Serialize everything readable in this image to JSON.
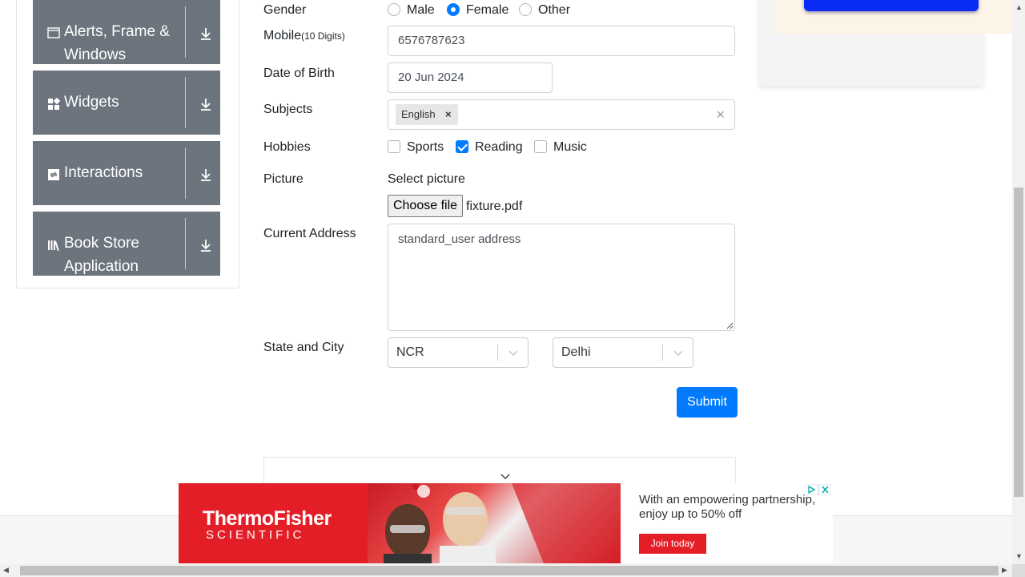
{
  "sidebar": {
    "groups": [
      {
        "title_line1": "Alerts, Frame &",
        "title_line2": "Windows",
        "icon": "window-icon"
      },
      {
        "title_line1": "Widgets",
        "icon": "widgets-icon"
      },
      {
        "title_line1": "Interactions",
        "icon": "interactions-icon"
      },
      {
        "title_line1": "Book Store",
        "title_line2": "Application",
        "icon": "books-icon"
      }
    ]
  },
  "form": {
    "gender": {
      "label": "Gender",
      "options": [
        "Male",
        "Female",
        "Other"
      ],
      "selected": "Female"
    },
    "mobile": {
      "label": "Mobile",
      "hint": "(10 Digits)",
      "value": "6576787623"
    },
    "dob": {
      "label": "Date of Birth",
      "value": "20 Jun 2024"
    },
    "subjects": {
      "label": "Subjects",
      "chips": [
        "English"
      ],
      "remove_symbol": "×",
      "clear_symbol": "×"
    },
    "hobbies": {
      "label": "Hobbies",
      "options": [
        "Sports",
        "Reading",
        "Music"
      ],
      "checked": [
        "Reading"
      ]
    },
    "picture": {
      "label": "Picture",
      "caption": "Select picture",
      "button": "Choose file",
      "filename": "fixture.pdf"
    },
    "address": {
      "label": "Current Address",
      "value": "standard_user address"
    },
    "state_city": {
      "label": "State and City",
      "state": "NCR",
      "city": "Delhi"
    },
    "submit_label": "Submit"
  },
  "ad": {
    "brand_line1": "ThermoFisher",
    "brand_line2": "SCIENTIFIC",
    "text": "With an empowering partnership, enjoy up to 50% off",
    "cta": "Join today"
  },
  "colors": {
    "primary": "#007bff",
    "sidebar_group": "#6c757d",
    "ad_red": "#e41e26"
  }
}
